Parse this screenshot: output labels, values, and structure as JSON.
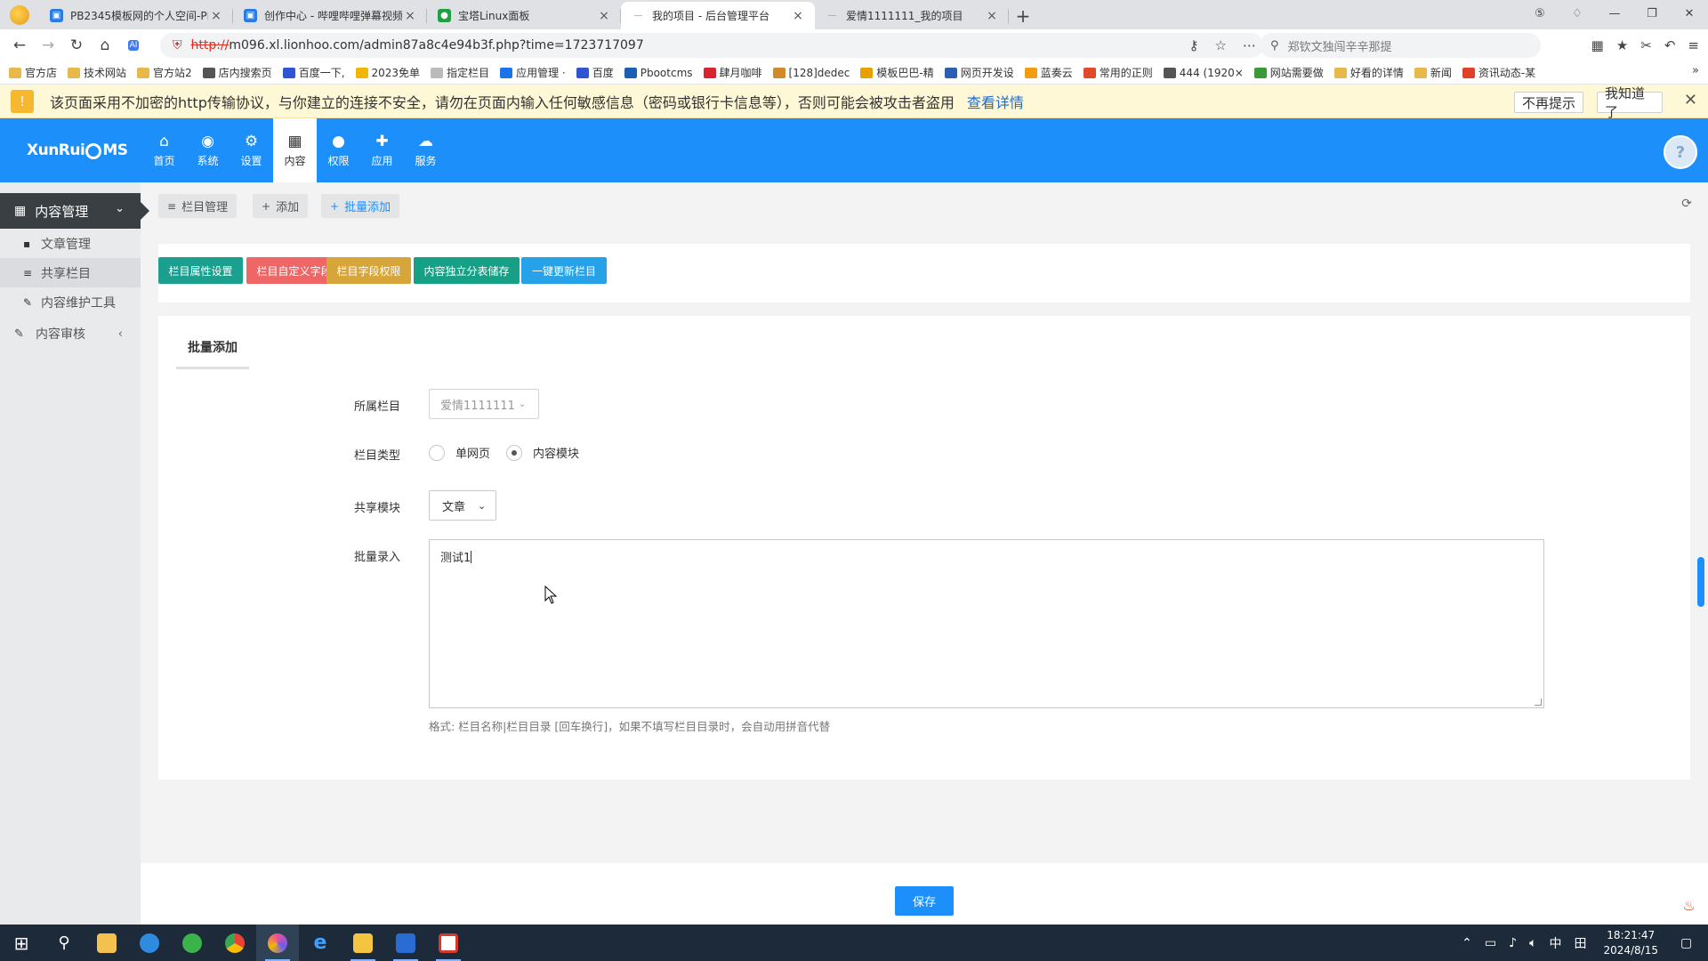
{
  "browser": {
    "tabs": [
      {
        "title": "PB2345模板网的个人空间-PB",
        "favicon_color": "#2a7be4",
        "favicon_glyph": "tv-icon",
        "active": false
      },
      {
        "title": "创作中心 - 哔哩哔哩弹幕视频",
        "favicon_color": "#2a7be4",
        "favicon_glyph": "tv-icon",
        "active": false
      },
      {
        "title": "宝塔Linux面板",
        "favicon_color": "#1fa045",
        "favicon_glyph": "shield-icon",
        "active": false
      },
      {
        "title": "我的项目 - 后台管理平台",
        "favicon_color": "#7aa6c2",
        "favicon_glyph": "dash-icon",
        "active": true
      },
      {
        "title": "爱情1111111_我的项目",
        "favicon_color": "#7aa6c2",
        "favicon_glyph": "dash-icon",
        "active": false
      }
    ],
    "url_protocol": "http://",
    "url_rest": "m096.xl.lionhoo.com/admin87a8c4e94b3f.php?time=1723717097",
    "search_placeholder": "郑钦文独闯辛辛那提",
    "bookmarks": [
      {
        "label": "官方店",
        "color": "#e8b84a"
      },
      {
        "label": "技术网站",
        "color": "#e8b84a"
      },
      {
        "label": "官方站2",
        "color": "#e8b84a"
      },
      {
        "label": "店内搜索页",
        "color": "#555555"
      },
      {
        "label": "百度一下,",
        "color": "#2f55d4"
      },
      {
        "label": "2023免单",
        "color": "#f2b705"
      },
      {
        "label": "指定栏目",
        "color": "#bbbbbb"
      },
      {
        "label": "应用管理 ·",
        "color": "#1a73e8"
      },
      {
        "label": "百度",
        "color": "#2f55d4"
      },
      {
        "label": "Pbootcms",
        "color": "#1a5fb4"
      },
      {
        "label": "肆月咖啡",
        "color": "#d9232e"
      },
      {
        "label": "[128]dedec",
        "color": "#d08a2a"
      },
      {
        "label": "模板巴巴-精",
        "color": "#e6a100"
      },
      {
        "label": "网页开发设",
        "color": "#2a5fb4"
      },
      {
        "label": "蓝奏云",
        "color": "#f29c11"
      },
      {
        "label": "常用的正则",
        "color": "#e04a2a"
      },
      {
        "label": "444 (1920×",
        "color": "#555555"
      },
      {
        "label": "网站需要做",
        "color": "#3a9a3a"
      },
      {
        "label": "好看的详情",
        "color": "#e8b84a"
      },
      {
        "label": "新闻",
        "color": "#e8b84a"
      },
      {
        "label": "资讯动态-某",
        "color": "#e0402a"
      }
    ],
    "warning": {
      "text": "该页面采用不加密的http传输协议，与你建立的连接不安全，请勿在页面内输入任何敏感信息（密码或银行卡信息等），否则可能会被攻击者盗用",
      "link": "查看详情",
      "btn_no_remind": "不再提示",
      "btn_ok": "我知道了"
    }
  },
  "cms": {
    "brand": {
      "pre": "XunRui",
      "post": "MS"
    },
    "topnav": [
      {
        "label": "首页",
        "icon": "home-icon",
        "glyph": "⌂",
        "active": false
      },
      {
        "label": "系统",
        "icon": "globe-icon",
        "glyph": "◉",
        "active": false
      },
      {
        "label": "设置",
        "icon": "gears-icon",
        "glyph": "⚙",
        "active": false
      },
      {
        "label": "内容",
        "icon": "grid-icon",
        "glyph": "▦",
        "active": true
      },
      {
        "label": "权限",
        "icon": "user-icon",
        "glyph": "●",
        "active": false
      },
      {
        "label": "应用",
        "icon": "puzzle-icon",
        "glyph": "✚",
        "active": false
      },
      {
        "label": "服务",
        "icon": "cloud-icon",
        "glyph": "☁",
        "active": false
      }
    ],
    "sidebar": {
      "section": "内容管理",
      "items": [
        {
          "label": "文章管理",
          "glyph": "▪",
          "active": false
        },
        {
          "label": "共享栏目",
          "glyph": "≡",
          "active": true
        },
        {
          "label": "内容维护工具",
          "glyph": "✎",
          "active": false
        }
      ],
      "section2": "内容审核"
    },
    "crumbs": [
      {
        "label": "栏目管理",
        "glyph": "≡"
      },
      {
        "label": "添加",
        "glyph": "+"
      },
      {
        "label": "批量添加",
        "glyph": "+"
      }
    ],
    "toolbar": [
      {
        "label": "栏目属性设置",
        "color": "#1ba090"
      },
      {
        "label": "栏目自定义字段",
        "color": "#ee6666"
      },
      {
        "label": "栏目字段权限",
        "color": "#d6a63b"
      },
      {
        "label": "内容独立分表储存",
        "color": "#16a085"
      },
      {
        "label": "一键更新栏目",
        "color": "#26a2e8"
      }
    ],
    "form": {
      "tab": "批量添加",
      "category_label": "所属栏目",
      "category_value": "爱情1111111",
      "type_label": "栏目类型",
      "type_options": [
        "单网页",
        "内容模块"
      ],
      "type_selected": "内容模块",
      "module_label": "共享模块",
      "module_value": "文章",
      "batch_label": "批量录入",
      "batch_value": "测试1",
      "help": "格式: 栏目名称|栏目目录 [回车换行]，如果不填写栏目目录时，会自动用拼音代替"
    },
    "save": "保存"
  },
  "taskbar": {
    "time": "18:21:47",
    "date": "2024/8/15",
    "ime": "中"
  }
}
